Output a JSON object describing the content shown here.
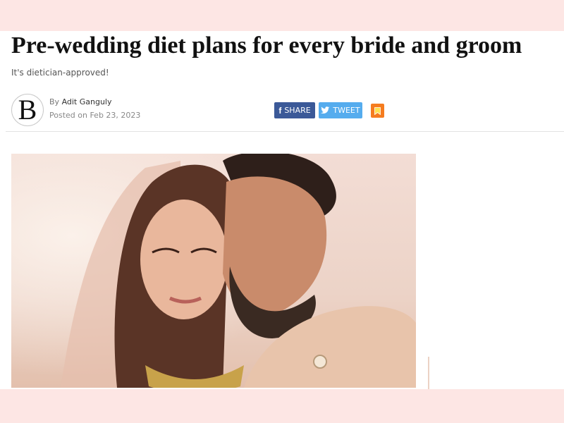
{
  "article": {
    "title": "Pre-wedding diet plans for every bride and groom",
    "subtitle": "It's dietician-approved!",
    "byline_prefix": "By",
    "author": "Adit Ganguly",
    "posted": "Posted on Feb 23, 2023"
  },
  "brand": {
    "logo_letter": "B"
  },
  "share": {
    "share_label": "SHARE",
    "share_glyph": "f",
    "tweet_label": "TWEET"
  },
  "icons": {
    "share": "facebook-icon",
    "tweet": "twitter-icon",
    "save": "bookmark-icon"
  },
  "colors": {
    "band": "#fde6e4",
    "facebook": "#3b5998",
    "twitter": "#55acee",
    "bookmark": "#f57c1f"
  }
}
